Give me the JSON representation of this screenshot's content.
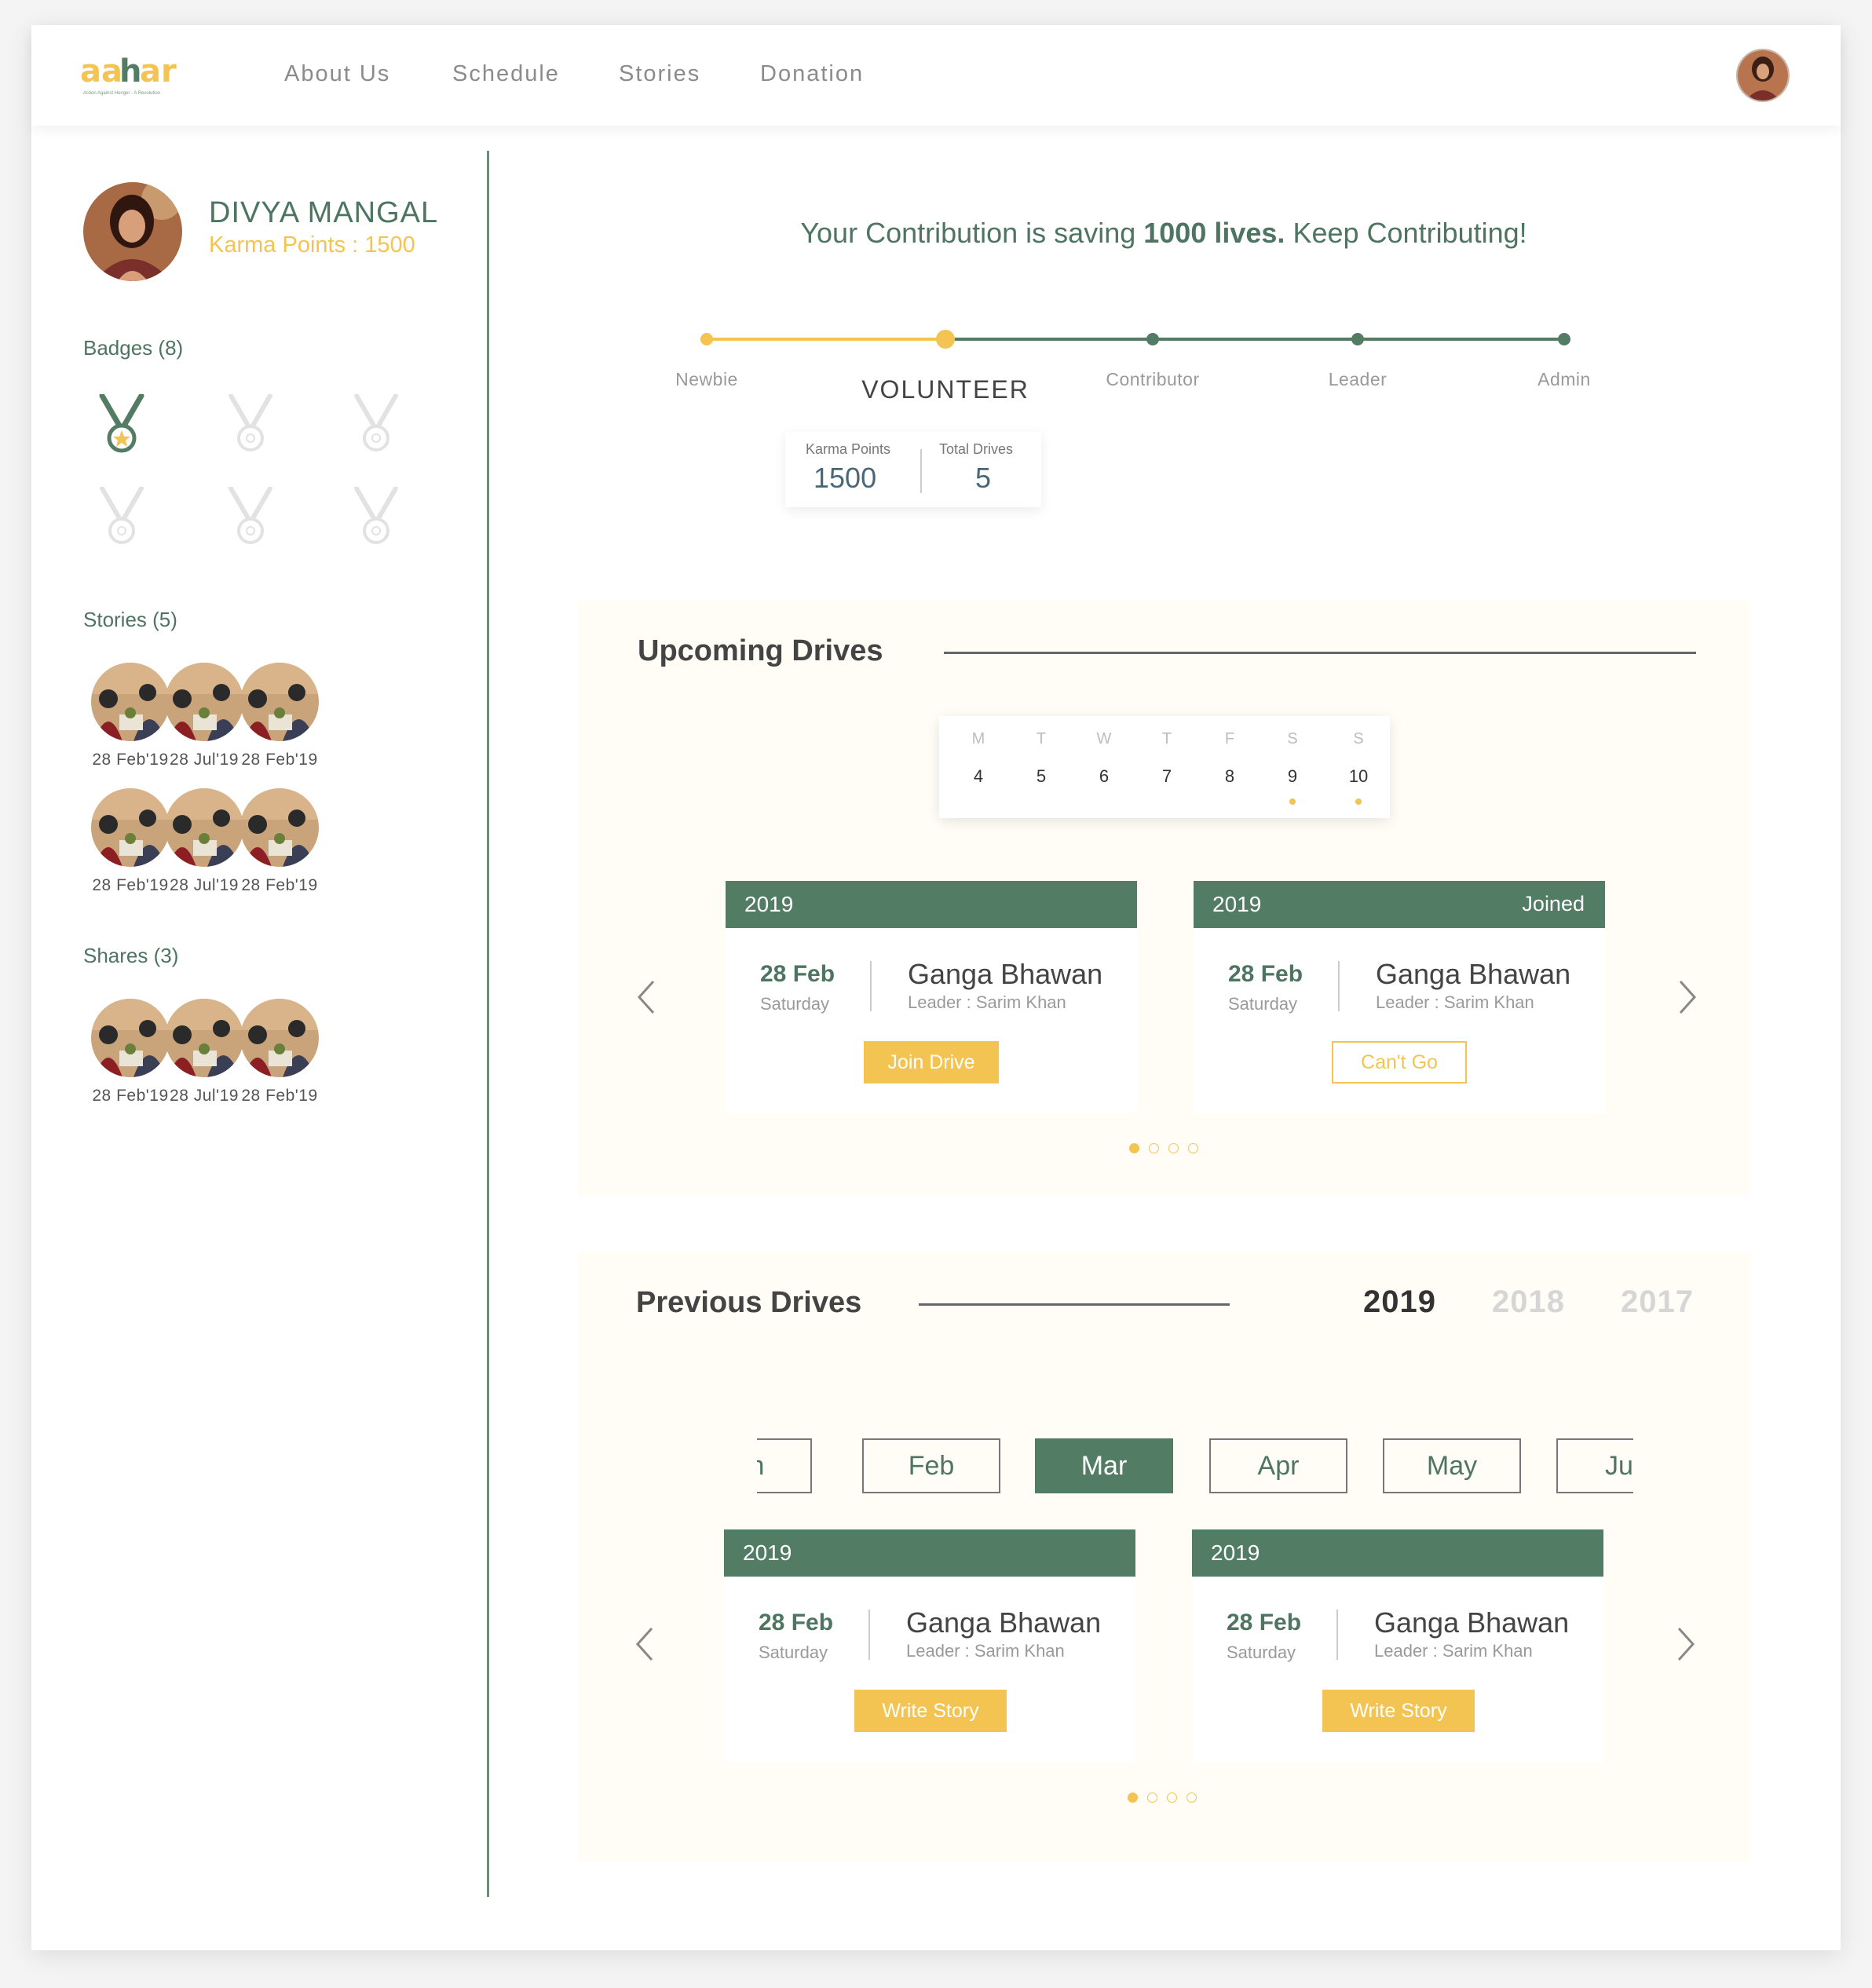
{
  "brand": {
    "logo_text": "aahar",
    "logo_tagline": "Action Against Hunger - A Revolution"
  },
  "nav": {
    "items": [
      "About Us",
      "Schedule",
      "Stories",
      "Donation"
    ]
  },
  "profile": {
    "name": "DIVYA MANGAL",
    "karma_label": "Karma Points : 1500"
  },
  "badges": {
    "title": "Badges (8)",
    "earned": 1,
    "shown": 6
  },
  "stories": {
    "title": "Stories (5)",
    "dates": [
      "28 Feb'19",
      "28 Jul'19",
      "28 Feb'19",
      "28 Feb'19",
      "28 Jul'19",
      "28 Feb'19"
    ]
  },
  "shares": {
    "title": "Shares (3)",
    "dates": [
      "28 Feb'19",
      "28 Jul'19",
      "28 Feb'19"
    ]
  },
  "contribution": {
    "prefix": "Your Contribution is saving",
    "highlight": "1000 lives.",
    "suffix": "Keep Contributing!"
  },
  "levels": {
    "items": [
      "Newbie",
      "VOLUNTEER",
      "Contributor",
      "Leader",
      "Admin"
    ],
    "current": "VOLUNTEER"
  },
  "stats": {
    "karma_label": "Karma Points",
    "karma_value": "1500",
    "drives_label": "Total Drives",
    "drives_value": "5"
  },
  "upcoming": {
    "title": "Upcoming Drives",
    "calendar": {
      "days": [
        "M",
        "T",
        "W",
        "T",
        "F",
        "S",
        "S"
      ],
      "dates": [
        "4",
        "5",
        "6",
        "7",
        "8",
        "9",
        "10"
      ],
      "marked": [
        "9",
        "10"
      ]
    },
    "cards": [
      {
        "year": "2019",
        "status": "",
        "date": "28 Feb",
        "day": "Saturday",
        "place": "Ganga Bhawan",
        "leader": "Leader : Sarim Khan",
        "action": "Join Drive"
      },
      {
        "year": "2019",
        "status": "Joined",
        "date": "28 Feb",
        "day": "Saturday",
        "place": "Ganga Bhawan",
        "leader": "Leader : Sarim Khan",
        "action": "Can't Go"
      }
    ],
    "page": 1,
    "pages": 4
  },
  "previous": {
    "title": "Previous Drives",
    "years": [
      "2019",
      "2018",
      "2017"
    ],
    "selected_year": "2019",
    "months": [
      "Jan",
      "Feb",
      "Mar",
      "Apr",
      "May",
      "Jun"
    ],
    "selected_month": "Mar",
    "cards": [
      {
        "year": "2019",
        "date": "28 Feb",
        "day": "Saturday",
        "place": "Ganga Bhawan",
        "leader": "Leader : Sarim Khan",
        "action": "Write Story"
      },
      {
        "year": "2019",
        "date": "28 Feb",
        "day": "Saturday",
        "place": "Ganga Bhawan",
        "leader": "Leader : Sarim Khan",
        "action": "Write Story"
      }
    ],
    "page": 1,
    "pages": 4
  },
  "colors": {
    "green": "#537c65",
    "yellow": "#f4c452",
    "panel": "#fffdf6"
  }
}
